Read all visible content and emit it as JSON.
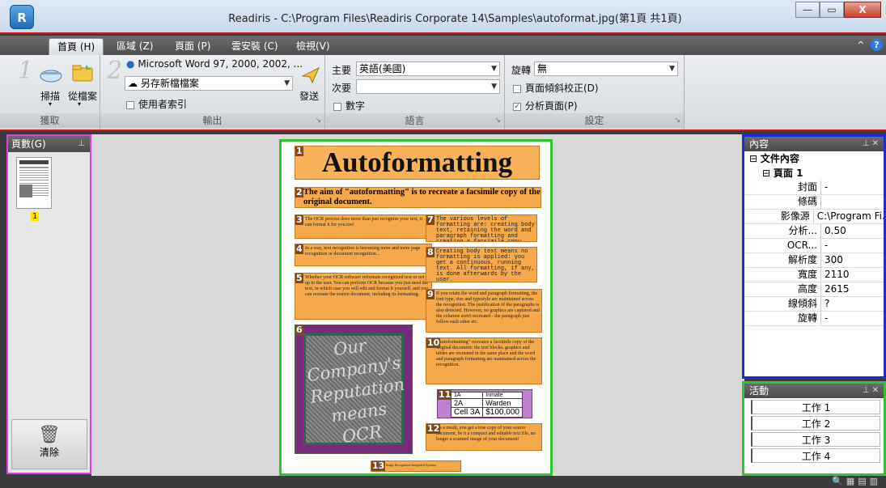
{
  "window": {
    "title": "Readiris - C:\\Program Files\\Readiris Corporate 14\\Samples\\autoformat.jpg(第1頁 共1頁)",
    "app_icon": "readiris-logo-icon",
    "minimize": "—",
    "maximize": "▭",
    "close": "X"
  },
  "tabs": [
    {
      "label": "首頁 (H)"
    },
    {
      "label": "區域 (Z)"
    },
    {
      "label": "頁面 (P)"
    },
    {
      "label": "雲安裝 (C)"
    },
    {
      "label": "檢視(V)"
    }
  ],
  "ribbon": {
    "acquire": {
      "step": "1",
      "scan": "掃描",
      "from_file": "從檔案",
      "group": "獲取"
    },
    "output": {
      "step": "2",
      "format": "Microsoft Word 97, 2000, 2002, ...",
      "save_as": "另存新檔檔案",
      "user_index": "使用者索引",
      "send": "發送",
      "group": "輸出"
    },
    "language": {
      "primary_label": "主要",
      "primary_value": "英語(美國)",
      "secondary_label": "次要",
      "secondary_value": "",
      "numbers": "數字",
      "group": "語言"
    },
    "settings": {
      "rotate_label": "旋轉",
      "rotate_value": "無",
      "deskew": "頁面傾斜校正(D)",
      "analyze": "分析頁面(P)",
      "group": "設定"
    }
  },
  "pages_panel": {
    "title": "頁數(G)",
    "page_number": "1",
    "clear": "清除"
  },
  "document": {
    "title": "Autoformatting",
    "intro": "The aim of \"autoformatting\" is to recreate a facsimile copy of the original document.",
    "zones": [
      {
        "n": "1"
      },
      {
        "n": "2"
      },
      {
        "n": "3",
        "text": "The OCR process does more than just recognize your text, it can format it for you too!"
      },
      {
        "n": "4",
        "text": "In a way, text recognition is becoming more and more page recognition or document recognition..."
      },
      {
        "n": "5",
        "text": "Whether your OCR software reformats recognized text or not is up to the user. You can perform OCR because you just need the text, in which case you will edit and format it yourself, and you can recreate the source document, including its formatting."
      },
      {
        "n": "6",
        "text": "Our Company's Reputation means OCR"
      },
      {
        "n": "7",
        "text": "The various levels of formatting are: creating body text, retaining the word and paragraph formatting and creating a facsimile copy."
      },
      {
        "n": "8",
        "text": "Creating body text means no formatting is applied: you get a continuous, running text. All formatting, if any, is done afterwards by the user."
      },
      {
        "n": "9",
        "text": "If you retain the word and paragraph formatting, the font type, size and typestyle are maintained across the recognition. The justification of the paragraphs is also detected. However, no graphics are captured and the columns aren't recreated - the paragraph just follow each other etc."
      },
      {
        "n": "10",
        "text": "\"Autoformatting\" recreates a facsimile copy of the original document: the text blocks, graphics and tables are recreated in the same place and the word and paragraph formatting are maintained across the recognition."
      },
      {
        "n": "11",
        "table": [
          [
            "1A",
            "Inmate"
          ],
          [
            "2A",
            "Warden"
          ],
          [
            "Cell 3A",
            "$100,000"
          ]
        ]
      },
      {
        "n": "12",
        "text": "As a result, you get a true copy of your source document, be it a compact and editable text file, no longer a scanned image of your document!"
      },
      {
        "n": "13",
        "text": "Image Recognition Integrated Systems"
      }
    ]
  },
  "content_panel": {
    "title": "內容",
    "root": "文件內容",
    "page": "頁面 1",
    "props": [
      {
        "k": "封面",
        "v": "-"
      },
      {
        "k": "條碼",
        "v": ""
      },
      {
        "k": "影像源",
        "v": "C:\\Program Fi..."
      },
      {
        "k": "分析...",
        "v": "0.50"
      },
      {
        "k": "OCR...",
        "v": "-"
      },
      {
        "k": "解析度",
        "v": "300"
      },
      {
        "k": "寬度",
        "v": "2110"
      },
      {
        "k": "高度",
        "v": "2615"
      },
      {
        "k": "線傾斜",
        "v": "?"
      },
      {
        "k": "旋轉",
        "v": "-"
      }
    ]
  },
  "activity_panel": {
    "title": "活動",
    "tasks": [
      "工作 1",
      "工作 2",
      "工作 3",
      "工作 4"
    ]
  },
  "colors": {
    "zone": "#f5a94a",
    "image_zone": "#7a2a7a",
    "table_zone": "#c080d0",
    "highlight_red": "#e01010",
    "highlight_green": "#2ec82e",
    "highlight_blue": "#1a2ee0",
    "highlight_magenta": "#e040e0"
  }
}
